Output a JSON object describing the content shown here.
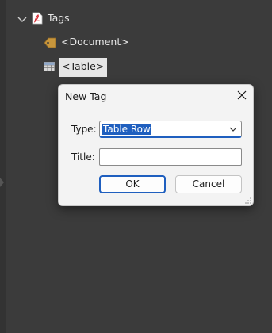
{
  "tree": {
    "root_label": "Tags",
    "items": [
      {
        "label": "<Document>"
      },
      {
        "label": "<Table>"
      }
    ]
  },
  "dialog": {
    "title": "New Tag",
    "type_label": "Type:",
    "type_value": "Table Row",
    "title_label": "Title:",
    "title_value": "",
    "ok_label": "OK",
    "cancel_label": "Cancel"
  },
  "colors": {
    "accent": "#1f5fbf",
    "panel_bg": "#3b3b3b",
    "dialog_bg": "#f3f3f3",
    "pdf_icon_red": "#d7262e",
    "tag_icon_gold": "#c8963c"
  },
  "icons": [
    "chevron-down-icon",
    "pdf-tags-icon",
    "tag-icon",
    "table-icon",
    "close-icon",
    "dropdown-caret-icon",
    "resize-grip-icon"
  ]
}
